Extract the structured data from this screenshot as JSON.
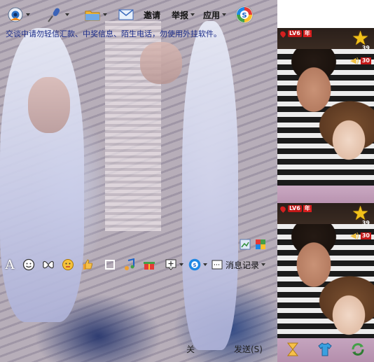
{
  "toolbar": {
    "invite_label": "邀请",
    "report_label": "举报",
    "apps_label": "应用"
  },
  "notice": "交谈中请勿轻信汇款、中奖信息、陌生电话，勿使用外挂软件。",
  "format_toolbar": {
    "font_glyph": "A",
    "message_record_label": "消息记录"
  },
  "bottom_bar": {
    "close_label": "关",
    "send_label": "发送(S)"
  },
  "profiles": [
    {
      "level": "LV6",
      "year_badge": "年",
      "star_count": "39",
      "volume": "30"
    },
    {
      "level": "LV6",
      "year_badge": "年",
      "star_count": "39",
      "volume": "30"
    }
  ],
  "colors": {
    "notice_text": "#1a2c8a",
    "star": "#f2c21a",
    "badge_red": "#c21818",
    "panel_bg": "#f3e6f0"
  }
}
